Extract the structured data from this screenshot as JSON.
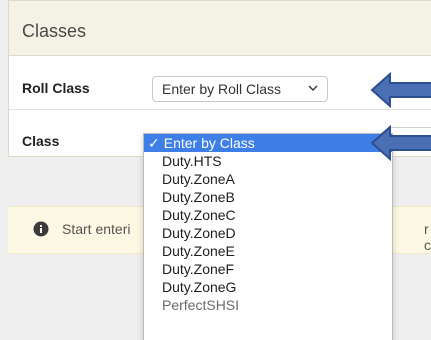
{
  "panel": {
    "title": "Classes",
    "roll_class_label": "Roll Class",
    "roll_class_value": "Enter by Roll Class",
    "class_label": "Class"
  },
  "class_dropdown": {
    "selected": "Enter by Class",
    "options": [
      "Enter by Class",
      "Duty.HTS",
      "Duty.ZoneA",
      "Duty.ZoneB",
      "Duty.ZoneC",
      "Duty.ZoneD",
      "Duty.ZoneE",
      "Duty.ZoneF",
      "Duty.ZoneG",
      "PerfectSHSI"
    ]
  },
  "alert": {
    "text_visible": "Start enteri",
    "text_tail": "r c",
    "icon": "info-circle-icon"
  },
  "annotations": {
    "arrow_color": "#3d5fa8",
    "arrow_icon": "left-arrow-icon"
  },
  "colors": {
    "header_bg": "#f3f2e4",
    "alert_bg": "#fcf8e3",
    "selected_bg": "#3d7fe6"
  }
}
